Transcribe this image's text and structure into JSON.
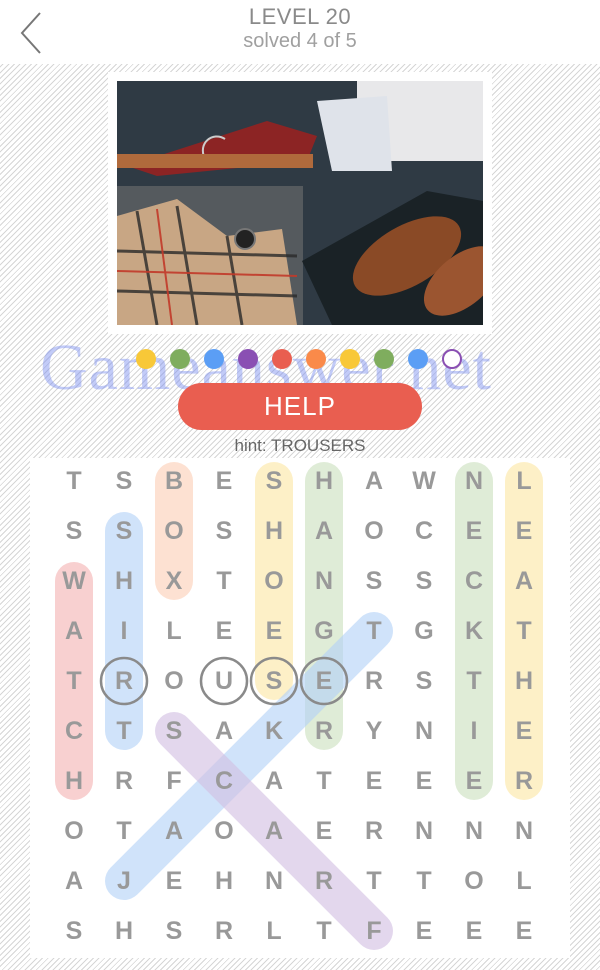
{
  "header": {
    "back_icon": "chevron-left-icon",
    "title": "LEVEL 20",
    "subtitle": "solved 4 of 5"
  },
  "photo": {
    "description": "flat-lay of men's clothing: jacket, red necktie, shirt, wooden hanger, trousers, plaid scarf, watch, leather shoes in box"
  },
  "progress_dots": [
    {
      "color": "#f8c838",
      "filled": true
    },
    {
      "color": "#7fad5e",
      "filled": true
    },
    {
      "color": "#5b9ef5",
      "filled": true
    },
    {
      "color": "#8a4fb3",
      "filled": true
    },
    {
      "color": "#e95e50",
      "filled": true
    },
    {
      "color": "#fa8a4a",
      "filled": true
    },
    {
      "color": "#f8c838",
      "filled": true
    },
    {
      "color": "#7fad5e",
      "filled": true
    },
    {
      "color": "#5b9ef5",
      "filled": true
    },
    {
      "color": "#8a4fb3",
      "filled": false
    }
  ],
  "help_button": {
    "label": "HELP"
  },
  "hint": "hint: TROUSERS",
  "watermark": "Gameanswer.net",
  "grid": [
    [
      "T",
      "S",
      "B",
      "E",
      "S",
      "H",
      "A",
      "W",
      "N",
      "L"
    ],
    [
      "S",
      "S",
      "O",
      "S",
      "H",
      "A",
      "O",
      "C",
      "E",
      "E"
    ],
    [
      "W",
      "H",
      "X",
      "T",
      "O",
      "N",
      "S",
      "S",
      "C",
      "A"
    ],
    [
      "A",
      "I",
      "L",
      "E",
      "E",
      "G",
      "T",
      "G",
      "K",
      "T"
    ],
    [
      "T",
      "R",
      "O",
      "U",
      "S",
      "E",
      "R",
      "S",
      "T",
      "H"
    ],
    [
      "C",
      "T",
      "S",
      "A",
      "K",
      "R",
      "Y",
      "N",
      "I",
      "E"
    ],
    [
      "H",
      "R",
      "F",
      "C",
      "A",
      "T",
      "E",
      "E",
      "E",
      "R"
    ],
    [
      "O",
      "T",
      "A",
      "O",
      "A",
      "E",
      "R",
      "N",
      "N",
      "N"
    ],
    [
      "A",
      "J",
      "E",
      "H",
      "N",
      "R",
      "T",
      "T",
      "O",
      "L"
    ],
    [
      "S",
      "H",
      "S",
      "R",
      "L",
      "T",
      "F",
      "E",
      "E",
      "E"
    ]
  ],
  "found_words": [
    {
      "word": "WATCH",
      "color": "#f5b4b4",
      "start": [
        2,
        0
      ],
      "end": [
        6,
        0
      ]
    },
    {
      "word": "SHIRT",
      "color": "#b4d2f8",
      "start": [
        1,
        1
      ],
      "end": [
        5,
        1
      ]
    },
    {
      "word": "BOX",
      "color": "#fcd0b8",
      "start": [
        0,
        2
      ],
      "end": [
        2,
        2
      ]
    },
    {
      "word": "SHOES",
      "color": "#fde7a6",
      "start": [
        0,
        4
      ],
      "end": [
        4,
        4
      ]
    },
    {
      "word": "HANGER",
      "color": "#cde1c0",
      "start": [
        0,
        5
      ],
      "end": [
        5,
        5
      ]
    },
    {
      "word": "NECKTIE",
      "color": "#cde1c0",
      "start": [
        0,
        8
      ],
      "end": [
        6,
        8
      ]
    },
    {
      "word": "LEATHER",
      "color": "#fde7a6",
      "start": [
        0,
        9
      ],
      "end": [
        6,
        9
      ]
    },
    {
      "word": "JACKET",
      "color": "#b4d2f8",
      "start": [
        8,
        1
      ],
      "end": [
        3,
        6
      ]
    },
    {
      "word": "SCARF",
      "color": "#d3c0e3",
      "start": [
        5,
        2
      ],
      "end": [
        9,
        6
      ]
    }
  ],
  "selected_cells": [
    [
      4,
      1
    ],
    [
      4,
      3
    ],
    [
      4,
      4
    ],
    [
      4,
      5
    ]
  ],
  "selection_ring_color": "#8a8a8a"
}
